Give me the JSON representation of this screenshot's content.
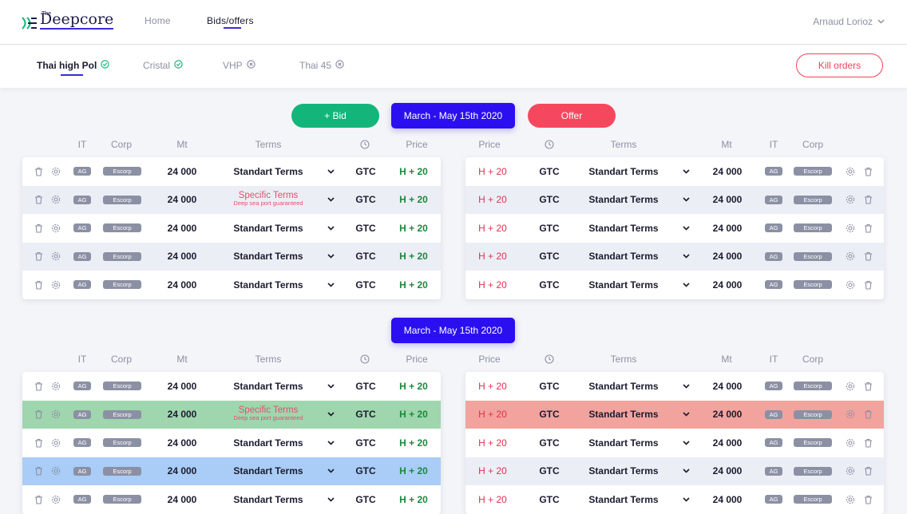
{
  "header": {
    "logo_small": "The",
    "logo_name": "Deepcore",
    "nav": [
      {
        "label": "Home"
      },
      {
        "label": "Bids/offers"
      }
    ],
    "user": "Arnaud Lorioz"
  },
  "products": [
    {
      "label": "Thai high Pol",
      "status": "check"
    },
    {
      "label": "Cristal",
      "status": "check"
    },
    {
      "label": "VHP",
      "status": "x"
    },
    {
      "label": "Thai 45",
      "status": "x"
    }
  ],
  "kill_orders": "Kill orders",
  "actions": {
    "bid": "+ Bid",
    "offer": "Offer"
  },
  "colors": {
    "accent": "#2b0ff0",
    "bid": "#14b57a",
    "offer": "#f5485f",
    "danger": "#f0415b",
    "green": "#1a8a3c",
    "red": "#e03050"
  },
  "sections": [
    {
      "period": "March - May 15th 2020",
      "bid_headers": {
        "it": "IT",
        "corp": "Corp",
        "mt": "Mt",
        "terms": "Terms",
        "price": "Price"
      },
      "offer_headers": {
        "price": "Price",
        "terms": "Terms",
        "mt": "Mt",
        "it": "IT",
        "corp": "Corp"
      },
      "bids": [
        {
          "it": "AG",
          "corp": "Escorp",
          "mt": "24 000",
          "terms": "Standart Terms",
          "validity": "GTC",
          "price": "H + 20",
          "highlight": "none"
        },
        {
          "it": "AG",
          "corp": "Escorp",
          "mt": "24 000",
          "terms": "Specific Terms",
          "terms_note": "Deep sea port guaranteed",
          "validity": "GTC",
          "price": "H + 20",
          "highlight": "alt"
        },
        {
          "it": "AG",
          "corp": "Escorp",
          "mt": "24 000",
          "terms": "Standart Terms",
          "validity": "GTC",
          "price": "H + 20",
          "highlight": "none"
        },
        {
          "it": "AG",
          "corp": "Escorp",
          "mt": "24 000",
          "terms": "Standart Terms",
          "validity": "GTC",
          "price": "H + 20",
          "highlight": "alt"
        },
        {
          "it": "AG",
          "corp": "Escorp",
          "mt": "24 000",
          "terms": "Standart Terms",
          "validity": "GTC",
          "price": "H + 20",
          "highlight": "none"
        }
      ],
      "offers": [
        {
          "price": "H + 20",
          "validity": "GTC",
          "terms": "Standart Terms",
          "mt": "24 000",
          "it": "AG",
          "corp": "Escorp",
          "highlight": "none"
        },
        {
          "price": "H + 20",
          "validity": "GTC",
          "terms": "Standart Terms",
          "mt": "24 000",
          "it": "AG",
          "corp": "Escorp",
          "highlight": "alt"
        },
        {
          "price": "H + 20",
          "validity": "GTC",
          "terms": "Standart Terms",
          "mt": "24 000",
          "it": "AG",
          "corp": "Escorp",
          "highlight": "none"
        },
        {
          "price": "H + 20",
          "validity": "GTC",
          "terms": "Standart Terms",
          "mt": "24 000",
          "it": "AG",
          "corp": "Escorp",
          "highlight": "alt"
        },
        {
          "price": "H + 20",
          "validity": "GTC",
          "terms": "Standart Terms",
          "mt": "24 000",
          "it": "AG",
          "corp": "Escorp",
          "highlight": "none"
        }
      ]
    },
    {
      "period": "March - May 15th 2020",
      "bid_headers": {
        "it": "IT",
        "corp": "Corp",
        "mt": "Mt",
        "terms": "Terms",
        "price": "Price"
      },
      "offer_headers": {
        "price": "Price",
        "terms": "Terms",
        "mt": "Mt",
        "it": "IT",
        "corp": "Corp"
      },
      "bids": [
        {
          "it": "AG",
          "corp": "Escorp",
          "mt": "24 000",
          "terms": "Standart Terms",
          "validity": "GTC",
          "price": "H + 20",
          "highlight": "none"
        },
        {
          "it": "AG",
          "corp": "Escorp",
          "mt": "24 000",
          "terms": "Specific Terms",
          "terms_note": "Deep sea port guaranteed",
          "validity": "GTC",
          "price": "H + 20",
          "highlight": "green"
        },
        {
          "it": "AG",
          "corp": "Escorp",
          "mt": "24 000",
          "terms": "Standart Terms",
          "validity": "GTC",
          "price": "H + 20",
          "highlight": "none"
        },
        {
          "it": "AG",
          "corp": "Escorp",
          "mt": "24 000",
          "terms": "Standart Terms",
          "validity": "GTC",
          "price": "H + 20",
          "highlight": "blue"
        },
        {
          "it": "AG",
          "corp": "Escorp",
          "mt": "24 000",
          "terms": "Standart Terms",
          "validity": "GTC",
          "price": "H + 20",
          "highlight": "none"
        }
      ],
      "offers": [
        {
          "price": "H + 20",
          "validity": "GTC",
          "terms": "Standart Terms",
          "mt": "24 000",
          "it": "AG",
          "corp": "Escorp",
          "highlight": "none"
        },
        {
          "price": "H + 20",
          "validity": "GTC",
          "terms": "Standart Terms",
          "mt": "24 000",
          "it": "AG",
          "corp": "Escorp",
          "highlight": "red"
        },
        {
          "price": "H + 20",
          "validity": "GTC",
          "terms": "Standart Terms",
          "mt": "24 000",
          "it": "AG",
          "corp": "Escorp",
          "highlight": "none"
        },
        {
          "price": "H + 20",
          "validity": "GTC",
          "terms": "Standart Terms",
          "mt": "24 000",
          "it": "AG",
          "corp": "Escorp",
          "highlight": "alt"
        },
        {
          "price": "H + 20",
          "validity": "GTC",
          "terms": "Standart Terms",
          "mt": "24 000",
          "it": "AG",
          "corp": "Escorp",
          "highlight": "none"
        }
      ]
    }
  ]
}
